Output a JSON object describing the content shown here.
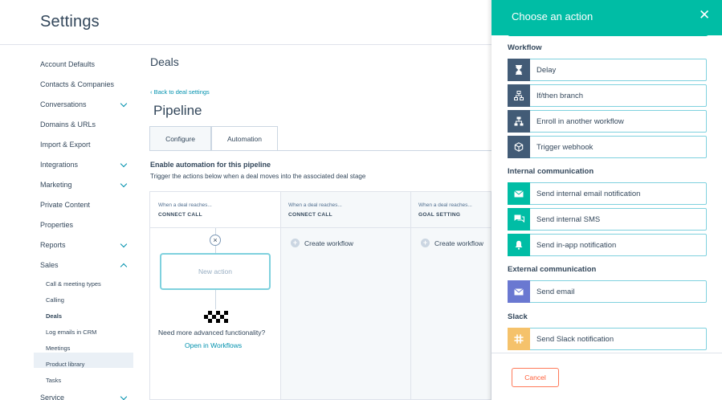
{
  "app": {
    "title": "Settings"
  },
  "sidebar": {
    "items": [
      {
        "label": "Account Defaults"
      },
      {
        "label": "Contacts & Companies"
      },
      {
        "label": "Conversations"
      },
      {
        "label": "Domains & URLs"
      },
      {
        "label": "Import & Export"
      },
      {
        "label": "Integrations"
      },
      {
        "label": "Marketing"
      },
      {
        "label": "Private Content"
      },
      {
        "label": "Properties"
      },
      {
        "label": "Reports"
      },
      {
        "label": "Sales"
      }
    ],
    "sales_sub": [
      {
        "label": "Call & meeting types"
      },
      {
        "label": "Calling"
      },
      {
        "label": "Deals"
      },
      {
        "label": "Log emails in CRM"
      },
      {
        "label": "Meetings"
      },
      {
        "label": "Product library"
      },
      {
        "label": "Tasks"
      }
    ],
    "last_item": "Service"
  },
  "main": {
    "title": "Deals",
    "back_link": "Back to deal settings",
    "pipeline_title": "Pipeline",
    "tabs": [
      {
        "label": "Configure"
      },
      {
        "label": "Automation"
      }
    ],
    "enable_title": "Enable automation for this pipeline",
    "enable_subtitle": "Trigger the actions below when a deal moves into the associated deal stage",
    "columns": [
      {
        "when": "When a deal reaches...",
        "stage": "CONNECT CALL"
      },
      {
        "when": "When a deal reaches...",
        "stage": "CONNECT CALL"
      },
      {
        "when": "When a deal reaches...",
        "stage": "GOAL SETTING"
      }
    ],
    "remove_glyph": "×",
    "new_action": "New action",
    "need_more": "Need more advanced functionality?",
    "open_workflows": "Open in Workflows",
    "create_workflow": "Create workflow",
    "plus_glyph": "+"
  },
  "panel": {
    "title": "Choose an action",
    "close_glyph": "✕",
    "groups": {
      "workflow": {
        "label": "Workflow",
        "actions": [
          {
            "label": "Delay",
            "icon": "hourglass-icon",
            "color": "#425b76"
          },
          {
            "label": "If/then branch",
            "icon": "branch-icon",
            "color": "#425b76"
          },
          {
            "label": "Enroll in another workflow",
            "icon": "workflow-icon",
            "color": "#425b76"
          },
          {
            "label": "Trigger webhook",
            "icon": "cube-icon",
            "color": "#425b76"
          }
        ]
      },
      "internal": {
        "label": "Internal communication",
        "actions": [
          {
            "label": "Send internal email notification",
            "icon": "envelope-icon",
            "color": "#00bda5"
          },
          {
            "label": "Send internal SMS",
            "icon": "chat-icon",
            "color": "#00bda5"
          },
          {
            "label": "Send in-app notification",
            "icon": "bell-icon",
            "color": "#00bda5"
          }
        ]
      },
      "external": {
        "label": "External communication",
        "actions": [
          {
            "label": "Send email",
            "icon": "envelope-icon",
            "color": "#6a78d1"
          }
        ]
      },
      "slack": {
        "label": "Slack",
        "actions": [
          {
            "label": "Send Slack notification",
            "icon": "slack-icon",
            "color": "#f5c26b"
          }
        ]
      }
    },
    "cancel_label": "Cancel"
  }
}
